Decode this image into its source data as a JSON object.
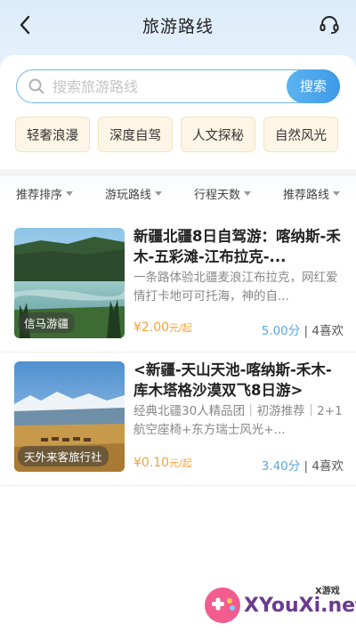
{
  "header": {
    "title": "旅游路线"
  },
  "search": {
    "placeholder": "搜索旅游路线",
    "button_label": "搜索"
  },
  "chips": [
    "轻奢浪漫",
    "深度自驾",
    "人文探秘",
    "自然风光"
  ],
  "filters": [
    "推荐排序",
    "游玩路线",
    "行程天数",
    "推荐路线"
  ],
  "routes": [
    {
      "title": "新疆北疆8日自驾游：喀纳斯-禾木-五彩滩-江布拉克-...",
      "description": "一条路体验北疆麦浪江布拉克，网红爱情打卡地可可托海，神的自...",
      "agency": "信马游疆",
      "price": "¥2.00",
      "price_unit": "元/起",
      "score": "5.00分",
      "likes": "4喜欢"
    },
    {
      "title": "<新疆-天山天池-喀纳斯-禾木-库木塔格沙漠双飞8日游>",
      "description": "经典北疆30人精品团｜初游推荐｜2+1航空座椅+东方瑞士风光+...",
      "agency": "天外来客旅行社",
      "price": "¥0.10",
      "price_unit": "元/起",
      "score": "3.40分",
      "likes": "4喜欢"
    }
  ],
  "watermark": {
    "text": "XYouXi.net",
    "small": "X游戏"
  },
  "colors": {
    "accent": "#4aa6ec",
    "price": "#f0a23c",
    "chip_bg": "#fdf6e6"
  }
}
